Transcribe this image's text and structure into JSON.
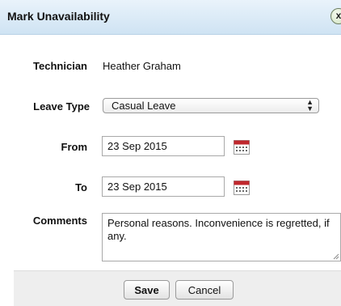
{
  "dialog": {
    "title": "Mark Unavailability",
    "close_label": "x"
  },
  "form": {
    "technician_label": "Technician",
    "technician_value": "Heather Graham",
    "leave_type_label": "Leave Type",
    "leave_type_value": "Casual Leave",
    "from_label": "From",
    "from_value": "23 Sep 2015",
    "to_label": "To",
    "to_value": "23 Sep 2015",
    "comments_label": "Comments",
    "comments_value": "Personal reasons. Inconvenience is regretted, if any."
  },
  "footer": {
    "save_label": "Save",
    "cancel_label": "Cancel"
  },
  "icons": {
    "calendar": "calendar-icon",
    "close": "close-icon",
    "select_arrows": "chevron-up-down-icon"
  },
  "colors": {
    "titlebar": "#cfe3f3",
    "calendar_accent": "#c0272d",
    "footer": "#eeeeee"
  }
}
